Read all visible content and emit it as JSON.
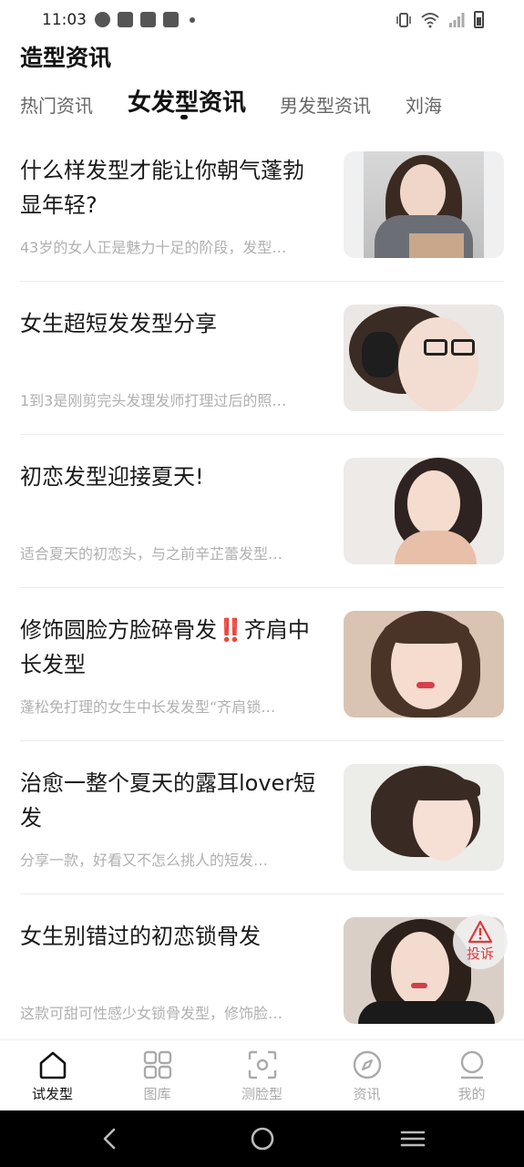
{
  "status_bar": {
    "time": "11:03",
    "left_icons": [
      "speedometer-icon",
      "mail-icon",
      "mail-icon",
      "mail-icon",
      "dot-icon"
    ],
    "right_icons": [
      "vibrate-icon",
      "wifi-icon",
      "signal-icon",
      "battery-icon"
    ]
  },
  "header": {
    "title": "造型资讯"
  },
  "tabs": [
    {
      "label": "热门资讯",
      "active": false
    },
    {
      "label": "女发型资讯",
      "active": true
    },
    {
      "label": "男发型资讯",
      "active": false
    },
    {
      "label": "刘海",
      "active": false
    }
  ],
  "articles": [
    {
      "title": "什么样发型才能让你朝气蓬勃显年轻?",
      "desc": "43岁的女人正是魅力十足的阶段，发型…"
    },
    {
      "title": "女生超短发发型分享",
      "desc": "1到3是刚剪完头发理发师打理过后的照…"
    },
    {
      "title": "初恋发型迎接夏天!",
      "desc": "适合夏天的初恋头，与之前辛芷蕾发型…"
    },
    {
      "title": "修饰圆脸方脸碎骨发‼️齐肩中长发型",
      "desc": "蓬松免打理的女生中长发发型“齐肩锁…"
    },
    {
      "title": "治愈一整个夏天的露耳lover短发",
      "desc": "分享一款，好看又不怎么挑人的短发…"
    },
    {
      "title": "女生别错过的初恋锁骨发",
      "desc": "这款可甜可性感少女锁骨发型，修饰脸…"
    }
  ],
  "report_button": {
    "label": "投诉",
    "icon": "warning-icon",
    "color": "#e0383a"
  },
  "bottom_nav": [
    {
      "label": "试发型",
      "icon": "home-icon",
      "active": true
    },
    {
      "label": "图库",
      "icon": "grid-icon",
      "active": false
    },
    {
      "label": "测脸型",
      "icon": "face-scan-icon",
      "active": false
    },
    {
      "label": "资讯",
      "icon": "compass-icon",
      "active": false
    },
    {
      "label": "我的",
      "icon": "profile-icon",
      "active": false
    }
  ],
  "system_nav": {
    "buttons": [
      "back-icon",
      "home-circle-icon",
      "menu-icon"
    ]
  }
}
